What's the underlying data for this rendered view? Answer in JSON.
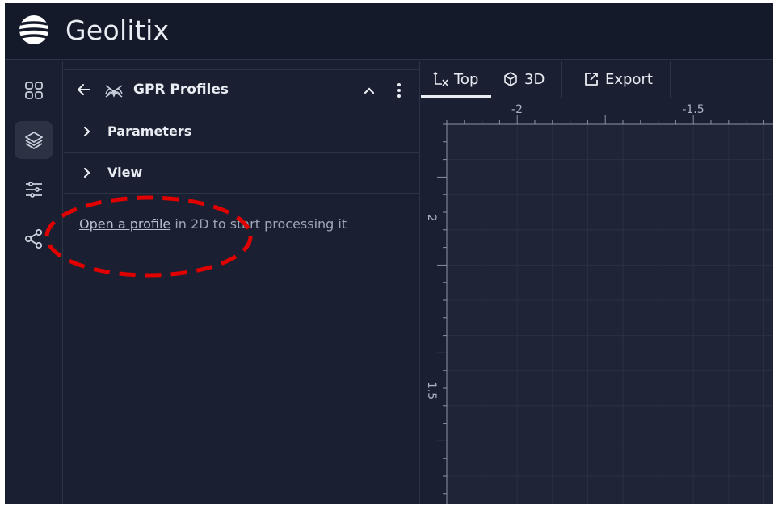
{
  "app": {
    "title": "Geolitix"
  },
  "rail": {
    "items": [
      {
        "name": "dashboard-icon",
        "active": false
      },
      {
        "name": "layers-icon",
        "active": true
      },
      {
        "name": "sliders-icon",
        "active": false
      },
      {
        "name": "share-icon",
        "active": false
      }
    ]
  },
  "panel": {
    "title": "GPR Profiles",
    "sections": [
      {
        "label": "Parameters",
        "icon": "chevron-right-icon"
      },
      {
        "label": "View",
        "icon": "chevron-right-icon"
      }
    ],
    "info": {
      "link_text": "Open a profile",
      "rest_text": " in 2D to start processing it"
    }
  },
  "viewer": {
    "tabs": [
      {
        "label": "Top",
        "icon": "axes-top-icon",
        "active": true
      },
      {
        "label": "3D",
        "icon": "cube-icon",
        "active": false
      },
      {
        "label": "Export",
        "icon": "export-icon",
        "active": false
      }
    ],
    "x_ticks": [
      "-2",
      "-1.5"
    ],
    "y_ticks": [
      "2",
      "1.5"
    ]
  },
  "colors": {
    "background": "#1a2031",
    "header": "#141a29",
    "annotation": "#e00000"
  }
}
